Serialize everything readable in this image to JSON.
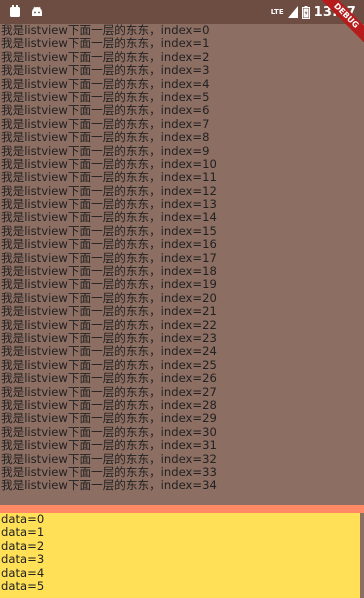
{
  "status_bar": {
    "network": "LTE",
    "time": "13:37"
  },
  "debug_banner": "DEBUG",
  "list": {
    "items": [
      "我是listview下面一层的东东，index=0",
      "我是listview下面一层的东东，index=1",
      "我是listview下面一层的东东，index=2",
      "我是listview下面一层的东东，index=3",
      "我是listview下面一层的东东，index=4",
      "我是listview下面一层的东东，index=5",
      "我是listview下面一层的东东，index=6",
      "我是listview下面一层的东东，index=7",
      "我是listview下面一层的东东，index=8",
      "我是listview下面一层的东东，index=9",
      "我是listview下面一层的东东，index=10",
      "我是listview下面一层的东东，index=11",
      "我是listview下面一层的东东，index=12",
      "我是listview下面一层的东东，index=13",
      "我是listview下面一层的东东，index=14",
      "我是listview下面一层的东东，index=15",
      "我是listview下面一层的东东，index=16",
      "我是listview下面一层的东东，index=17",
      "我是listview下面一层的东东，index=18",
      "我是listview下面一层的东东，index=19",
      "我是listview下面一层的东东，index=20",
      "我是listview下面一层的东东，index=21",
      "我是listview下面一层的东东，index=22",
      "我是listview下面一层的东东，index=23",
      "我是listview下面一层的东东，index=24",
      "我是listview下面一层的东东，index=25",
      "我是listview下面一层的东东，index=26",
      "我是listview下面一层的东东，index=27",
      "我是listview下面一层的东东，index=28",
      "我是listview下面一层的东东，index=29",
      "我是listview下面一层的东东，index=30",
      "我是listview下面一层的东东，index=31",
      "我是listview下面一层的东东，index=32",
      "我是listview下面一层的东东，index=33",
      "我是listview下面一层的东东，index=34"
    ]
  },
  "panel": {
    "items": [
      "data=0",
      "data=1",
      "data=2",
      "data=3",
      "data=4",
      "data=5"
    ]
  },
  "colors": {
    "background": "#8d6e63",
    "status_bar": "#6d4c41",
    "divider": "#ff8a65",
    "panel": "#ffe057",
    "debug_banner": "#b71c1c"
  }
}
